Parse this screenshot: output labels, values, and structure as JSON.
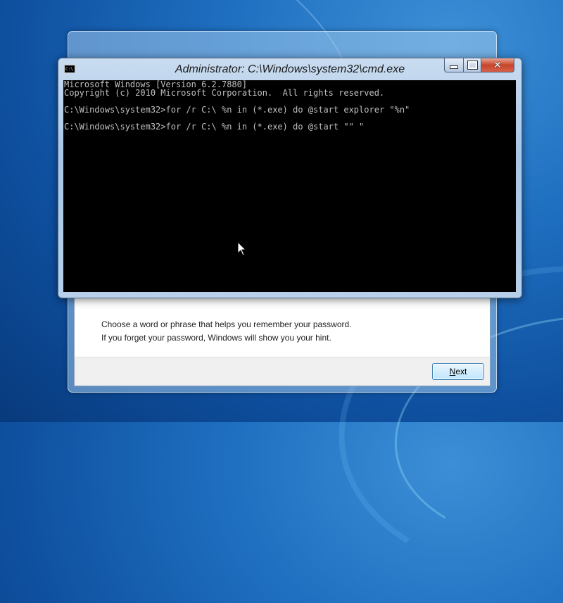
{
  "setup_window": {
    "hint_line_1": "Choose a word or phrase that helps you remember your password.",
    "hint_line_2": "If you forget your password, Windows will show you your hint.",
    "next_button": {
      "label_mnemonic": "N",
      "label_rest": "ext"
    }
  },
  "cmd_window": {
    "title": "Administrator: C:\\Windows\\system32\\cmd.exe",
    "app_icon": "cmd-icon",
    "app_icon_text": "C:\\",
    "caption_buttons": [
      "minimize-icon",
      "maximize-icon",
      "close-icon"
    ],
    "close_glyph": "✕",
    "console_lines": [
      "Microsoft Windows [Version 6.2.7880]",
      "Copyright (c) 2010 Microsoft Corporation.  All rights reserved.",
      "C:\\Windows\\system32>for /r C:\\ %n in (*.exe) do @start explorer \"%n\"",
      "C:\\Windows\\system32>for /r C:\\ %n in (*.exe) do @start \"\" \""
    ]
  },
  "colors": {
    "console_background": "#000000",
    "console_text": "#c0c0c0",
    "desktop_blue": "#1f6fc0",
    "close_button_red": "#c7452b"
  }
}
